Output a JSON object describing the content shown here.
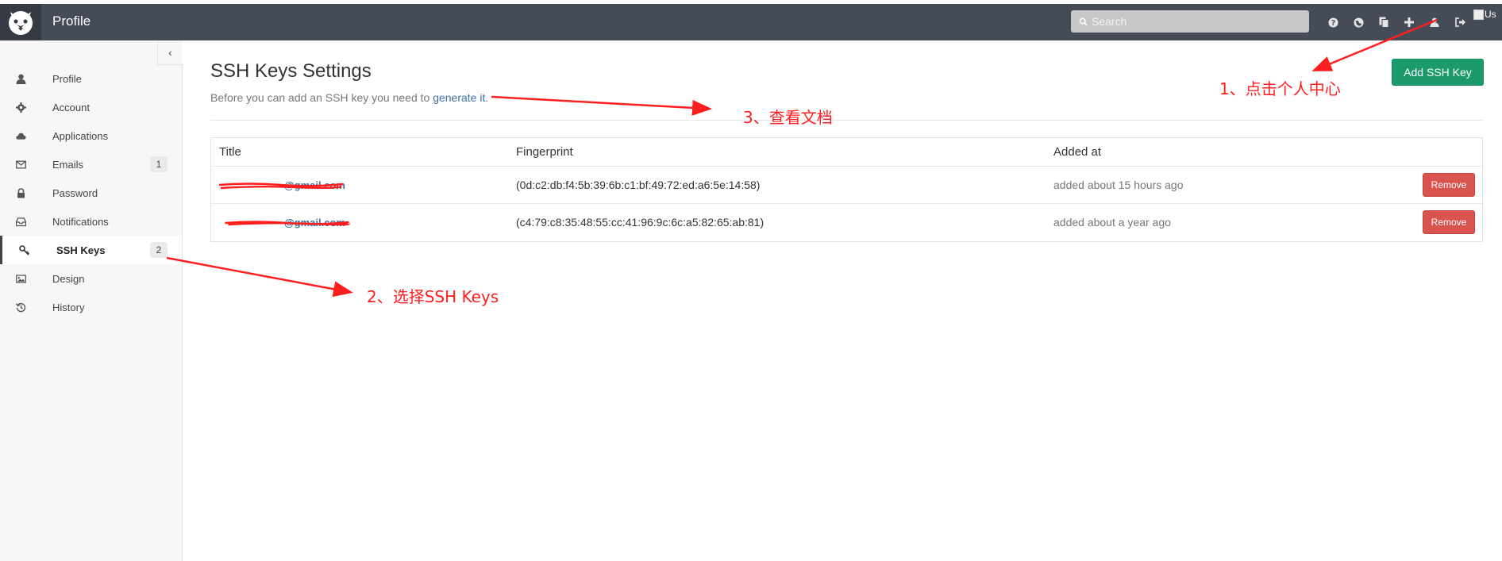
{
  "topbar": {
    "title": "Profile",
    "search_placeholder": "Search",
    "icons": [
      "help-icon",
      "globe-icon",
      "copy-icon",
      "plus-icon",
      "user-icon",
      "sign-out-icon"
    ],
    "avatar_alt": "Us"
  },
  "sidebar": {
    "collapse_glyph": "‹",
    "items": [
      {
        "label": "Profile",
        "icon": "user-icon"
      },
      {
        "label": "Account",
        "icon": "gear-icon"
      },
      {
        "label": "Applications",
        "icon": "cloud-icon"
      },
      {
        "label": "Emails",
        "icon": "envelope-icon",
        "count": "1"
      },
      {
        "label": "Password",
        "icon": "lock-icon"
      },
      {
        "label": "Notifications",
        "icon": "inbox-icon"
      },
      {
        "label": "SSH Keys",
        "icon": "key-icon",
        "count": "2",
        "active": true
      },
      {
        "label": "Design",
        "icon": "picture-icon"
      },
      {
        "label": "History",
        "icon": "history-icon"
      }
    ]
  },
  "main": {
    "title": "SSH Keys Settings",
    "lead_text": "Before you can add an SSH key you need to ",
    "lead_link": "generate it",
    "lead_end": ".",
    "add_button": "Add SSH Key",
    "table": {
      "headers": [
        "Title",
        "Fingerprint",
        "Added at"
      ],
      "rows": [
        {
          "title": "@gmail.com",
          "fingerprint": "(0d:c2:db:f4:5b:39:6b:c1:bf:49:72:ed:a6:5e:14:58)",
          "added": "added about 15 hours ago",
          "action": "Remove"
        },
        {
          "title": "@gmail.com",
          "fingerprint": "(c4:79:c8:35:48:55:cc:41:96:9c:6c:a5:82:65:ab:81)",
          "added": "added about a year ago",
          "action": "Remove"
        }
      ]
    }
  },
  "annotations": {
    "step1": "1、点击个人中心",
    "step2": "2、选择SSH Keys",
    "step3": "3、查看文档"
  },
  "colors": {
    "topbar": "#454b57",
    "primary_button": "#1b9a6b",
    "danger_button": "#d9534f",
    "link": "#3f6fa0",
    "annotation": "#ff1e1e"
  }
}
